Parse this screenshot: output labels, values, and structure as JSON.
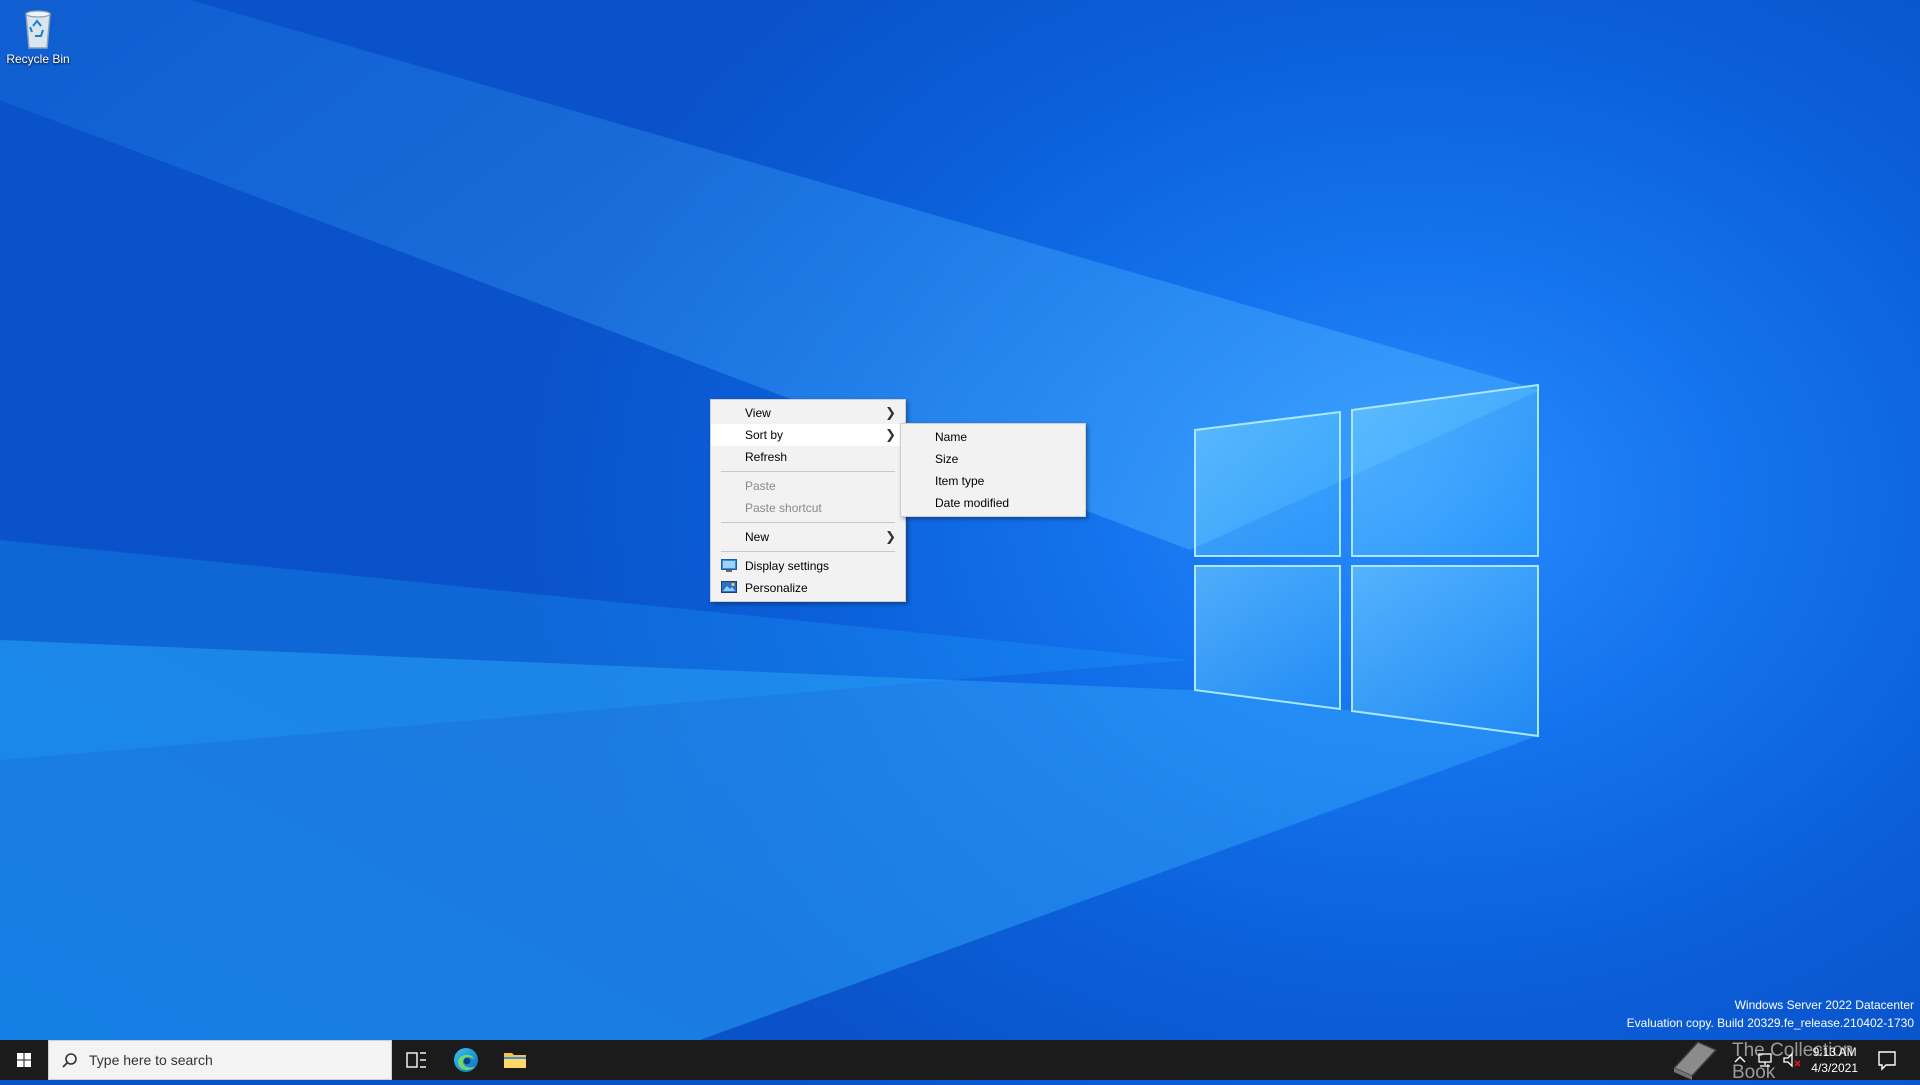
{
  "desktop": {
    "icons": [
      {
        "label": "Recycle Bin",
        "icon": "recycle-bin-icon"
      }
    ]
  },
  "context_menu": {
    "items": [
      {
        "label": "View",
        "has_submenu": true
      },
      {
        "label": "Sort by",
        "has_submenu": true
      },
      {
        "label": "Refresh"
      },
      {
        "label": "Paste",
        "disabled": true
      },
      {
        "label": "Paste shortcut",
        "disabled": true
      },
      {
        "label": "New",
        "has_submenu": true
      },
      {
        "label": "Display settings",
        "icon": "display-settings-icon"
      },
      {
        "label": "Personalize",
        "icon": "personalize-icon"
      }
    ],
    "submenu_arrow": ">"
  },
  "sort_submenu": {
    "items": [
      {
        "label": "Name"
      },
      {
        "label": "Size"
      },
      {
        "label": "Item type"
      },
      {
        "label": "Date modified"
      }
    ]
  },
  "watermark": {
    "line1": "Windows Server 2022 Datacenter",
    "line2": "Evaluation copy. Build 20329.fe_release.210402-1730"
  },
  "taskbar": {
    "search_placeholder": "Type here to search",
    "clock_time": "9:13 AM",
    "clock_date": "4/3/2021",
    "brand_text": "The Collection Book"
  },
  "colors": {
    "desktop_accent": "#0b5fd9",
    "taskbar_bg": "#1b1b1b",
    "menu_bg": "#f2f2f2"
  }
}
